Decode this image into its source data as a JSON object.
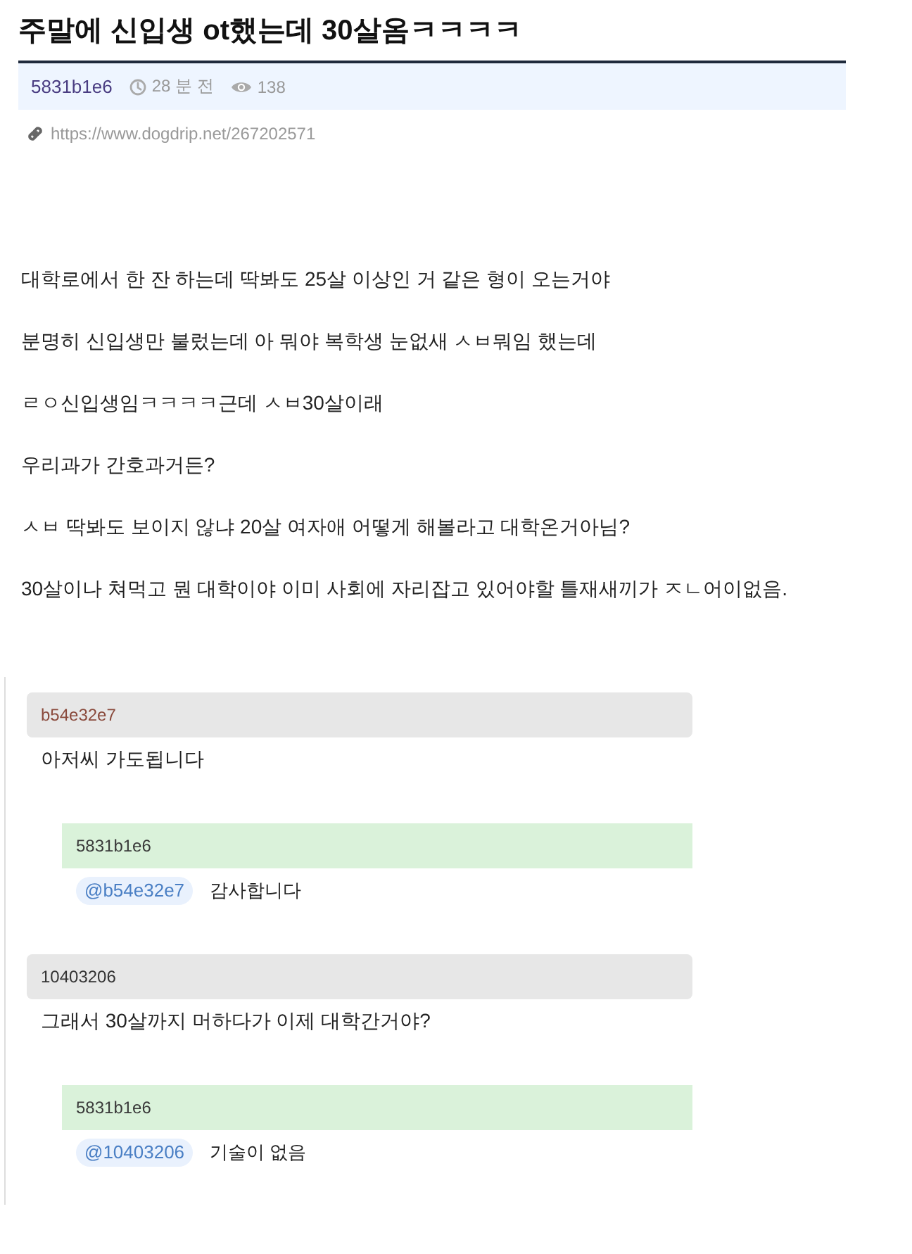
{
  "title": "주말에 신입생 ot했는데 30살옴ㅋㅋㅋㅋ",
  "meta": {
    "author": "5831b1e6",
    "time": "28 분 전",
    "views": "138"
  },
  "link": {
    "url": "https://www.dogdrip.net/267202571"
  },
  "body": [
    "대학로에서 한 잔 하는데 딱봐도 25살 이상인 거 같은 형이 오는거야",
    "분명히 신입생만 불렀는데 아 뭐야 복학생 눈없새 ㅅㅂ뭐임 했는데",
    "ㄹㅇ신입생임ㅋㅋㅋㅋ근데 ㅅㅂ30살이래",
    "우리과가 간호과거든?",
    "ㅅㅂ 딱봐도 보이지 않냐 20살 여자애 어떻게 해볼라고 대학온거아님?",
    "30살이나 쳐먹고 뭔 대학이야 이미 사회에 자리잡고 있어야할 틀재새끼가 ㅈㄴ어이없음."
  ],
  "comments": [
    {
      "author": "b54e32e7",
      "color": "#8a4a3c",
      "text": "아저씨 가도됩니다",
      "replies": [
        {
          "author": "5831b1e6",
          "mention": "@b54e32e7",
          "text": "감사합니다"
        }
      ]
    },
    {
      "author": "10403206",
      "color": "#333333",
      "text": "그래서 30살까지 머하다가 이제 대학간거야?",
      "replies": [
        {
          "author": "5831b1e6",
          "mention": "@10403206",
          "text": "기술이 없음"
        }
      ]
    }
  ]
}
